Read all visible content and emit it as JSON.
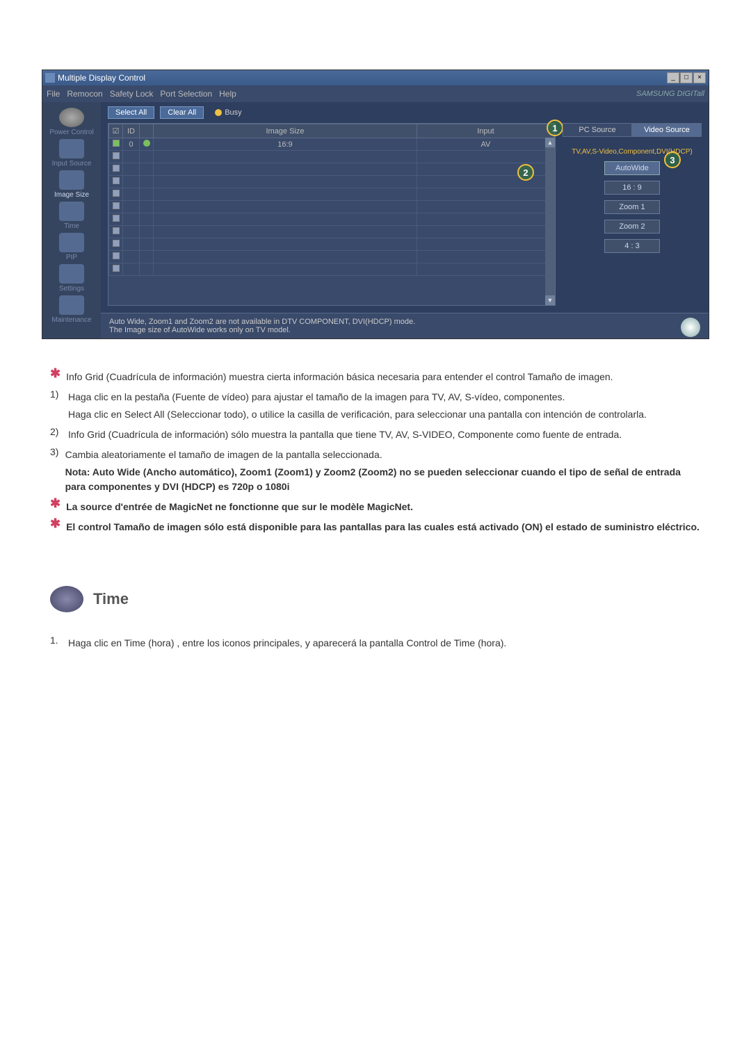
{
  "window": {
    "title": "Multiple Display Control"
  },
  "menu": {
    "file": "File",
    "remocon": "Remocon",
    "safety": "Safety Lock",
    "port": "Port Selection",
    "help": "Help",
    "brand": "SAMSUNG DIGITall"
  },
  "sidebar": [
    {
      "label": "Power Control"
    },
    {
      "label": "Input Source"
    },
    {
      "label": "Image Size"
    },
    {
      "label": "Time"
    },
    {
      "label": "PIP"
    },
    {
      "label": "Settings"
    },
    {
      "label": "Maintenance"
    }
  ],
  "toolbar": {
    "selectAll": "Select All",
    "clearAll": "Clear All",
    "busy": "Busy"
  },
  "grid": {
    "h_chk": "☑",
    "h_id": "ID",
    "h_st": "",
    "h_size": "Image Size",
    "h_input": "Input",
    "r1_id": "0",
    "r1_size": "16:9",
    "r1_input": "AV"
  },
  "tabs": {
    "pc": "PC Source",
    "video": "Video Source"
  },
  "note": "TV,AV,S-Video,Component,DVI(HDCP)",
  "modes": [
    "AutoWide",
    "16 : 9",
    "Zoom 1",
    "Zoom 2",
    "4 : 3"
  ],
  "status1": "Auto Wide, Zoom1 and Zoom2 are not available in DTV COMPONENT, DVI(HDCP) mode.",
  "status2": "The Image size of AutoWide works only on TV model.",
  "callouts": {
    "c1": "1",
    "c2": "2",
    "c3": "3"
  },
  "doc": {
    "p0": "Info Grid (Cuadrícula de información) muestra cierta información básica necesaria para entender el control Tamaño de imagen.",
    "p1a": "Haga clic en la pestaña (Fuente de vídeo) para ajustar el tamaño de la imagen para TV, AV, S-vídeo, componentes.",
    "p1b": "Haga clic en Select All (Seleccionar todo), o utilice la casilla de verificación, para seleccionar una pantalla con intención de controlarla.",
    "p2": "Info Grid (Cuadrícula de información) sólo muestra la pantalla que tiene TV, AV, S-VIDEO, Componente como fuente de entrada.",
    "p3": "Cambia aleatoriamente el tamaño de imagen de la pantalla seleccionada.",
    "p3n": "Nota: Auto Wide (Ancho automático), Zoom1 (Zoom1) y Zoom2 (Zoom2) no se pueden seleccionar cuando el tipo de señal de entrada para componentes y DVI (HDCP) es 720p o 1080i",
    "star1": "La source d'entrée de MagicNet ne fonctionne que sur le modèle MagicNet.",
    "star2": "El control Tamaño de imagen sólo está disponible para las pantallas para las cuales está activado (ON) el estado de suministro eléctrico."
  },
  "section": {
    "title": "Time",
    "body": "Haga clic en Time (hora) , entre los iconos principales, y aparecerá la pantalla Control de Time (hora)."
  }
}
